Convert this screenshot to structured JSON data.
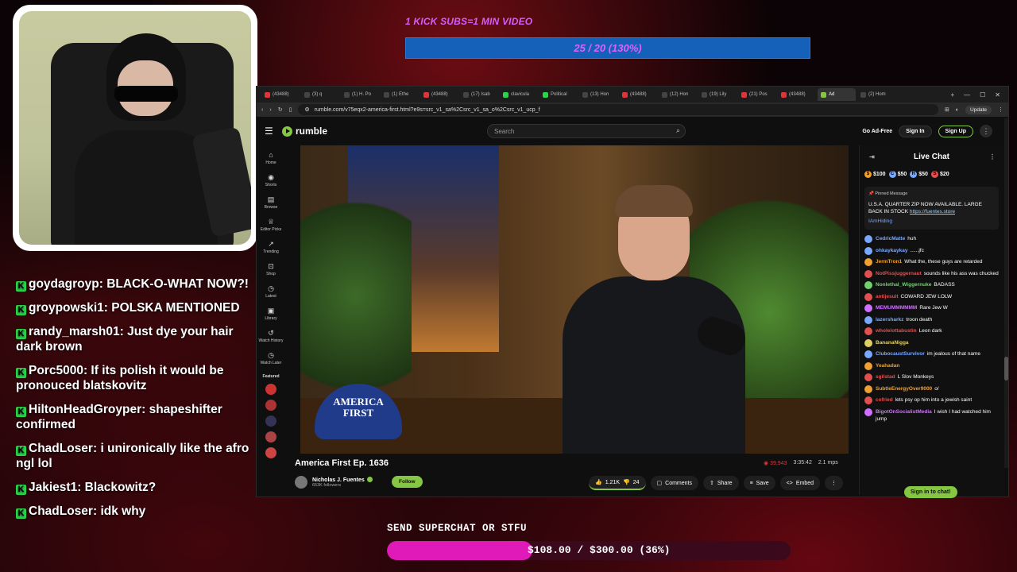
{
  "overlay": {
    "kick_goal_title": "1 KICK SUBS=1 MIN VIDEO",
    "kick_goal_value": "25 / 20 (130%)",
    "superchat_title": "SEND SUPERCHAT OR STFU",
    "superchat_value": "$108.00 / $300.00 (36%)",
    "superchat_progress": 0.36,
    "accent_pink": "#e01ab8",
    "accent_blue": "#1560b8"
  },
  "stream_chat": [
    {
      "user": "goydagroyp:",
      "text": "BLACK-O-WHAT NOW?!"
    },
    {
      "user": "groypowski1:",
      "text": "POLSKA MENTIONED"
    },
    {
      "user": "randy_marsh01:",
      "text": "Just dye your hair dark brown"
    },
    {
      "user": "Porc5000:",
      "text": "If its polish it would be pronouced blatskovitz"
    },
    {
      "user": "HiltonHeadGroyper:",
      "text": "shapeshifter confirmed"
    },
    {
      "user": "ChadLoser:",
      "text": "i unironically like the afro ngl lol"
    },
    {
      "user": "Jakiest1:",
      "text": "Blackowitz?"
    },
    {
      "user": "ChadLoser:",
      "text": "idk why"
    }
  ],
  "browser": {
    "tabs": [
      "(43488)",
      "(3) q",
      "(1) H. Po",
      "(1) Ethe",
      "(43488)",
      "(17) Isab",
      "clavicula",
      "Political",
      "(13) Hon",
      "(43488)",
      "(12) Hon",
      "(19) Lily",
      "(21) Pos",
      "(43488)",
      "Ad",
      "(2) Hom"
    ],
    "url": "rumble.com/v75eqx2-america-first.html?e9s=src_v1_sa%2Csrc_v1_sa_o%2Csrc_v1_ucp_f",
    "update_label": "Update"
  },
  "rumble": {
    "logo": "rumble",
    "search_placeholder": "Search",
    "ad_free": "Go Ad-Free",
    "sign_in": "Sign In",
    "sign_up": "Sign Up",
    "nav": [
      {
        "label": "Home",
        "icon": "home-icon",
        "glyph": "⌂"
      },
      {
        "label": "Shorts",
        "icon": "shorts-icon",
        "glyph": "◉"
      },
      {
        "label": "Browse",
        "icon": "browse-icon",
        "glyph": "▤"
      },
      {
        "label": "Editor Picks",
        "icon": "editor-picks-icon",
        "glyph": "♕"
      },
      {
        "label": "Trending",
        "icon": "trending-icon",
        "glyph": "↗"
      },
      {
        "label": "Shop",
        "icon": "shop-icon",
        "glyph": "⊡"
      },
      {
        "label": "Latest",
        "icon": "latest-icon",
        "glyph": "◷"
      },
      {
        "label": "Library",
        "icon": "library-icon",
        "glyph": "▣"
      },
      {
        "label": "Watch History",
        "icon": "history-icon",
        "glyph": "↺"
      },
      {
        "label": "Watch Later",
        "icon": "watch-later-icon",
        "glyph": "◷"
      }
    ],
    "featured_label": "Featured",
    "hat_text": "AMERICA FIRST",
    "video_title": "America First Ep. 1636",
    "viewers": "39,943",
    "duration": "3:35:42",
    "bitrate": "2.1 mps",
    "channel_name": "Nicholas J. Fuentes",
    "followers": "653K followers",
    "follow": "Follow",
    "likes": "1.21K",
    "dislikes": "24",
    "comments": "Comments",
    "share": "Share",
    "save": "Save",
    "embed": "Embed"
  },
  "live_chat": {
    "title": "Live Chat",
    "rants": [
      "$100",
      "$50",
      "$50",
      "$20"
    ],
    "pinned_label": "Pinned Message",
    "pinned_text": "U.S.A. QUARTER ZIP NOW AVAILABLE. LARGE BACK IN STOCK",
    "pinned_link": "https://fuentes.store",
    "pinned_author": "IAmHiding",
    "messages": [
      {
        "user": "CedricMatte",
        "text": "huh",
        "color": "#7aa8ff"
      },
      {
        "user": "ohkaykaykay",
        "text": "......jfc",
        "color": "#7aa8ff"
      },
      {
        "user": "JermTron1",
        "text": "What the, these guys are retarded",
        "color": "#f0a030"
      },
      {
        "user": "NotPissjuggernaut",
        "text": "sounds like his ass was chucked",
        "color": "#e05050"
      },
      {
        "user": "Nonlethal_Wiggernuke",
        "text": "BADASS",
        "color": "#70d070"
      },
      {
        "user": "antijesuit",
        "text": "COWARD JEW LOLW",
        "color": "#e05050"
      },
      {
        "user": "MEMUMMMMMM",
        "text": "Rare Jew W",
        "color": "#d070ff"
      },
      {
        "user": "lazersharkz",
        "text": "troon death",
        "color": "#7aa8ff"
      },
      {
        "user": "wholelottabustin",
        "text": "Leon dark",
        "color": "#e05050"
      },
      {
        "user": "BananaNigga",
        "text": "",
        "color": "#e0d060"
      },
      {
        "user": "ClubocaustSurvivor",
        "text": "im jealous of that name",
        "color": "#7aa8ff"
      },
      {
        "user": "Yeahadan",
        "text": "",
        "color": "#f0a030"
      },
      {
        "user": "sgilstad",
        "text": "L Slov Monkeys",
        "color": "#e05050"
      },
      {
        "user": "SubtleEnergyOver9000",
        "text": "o/",
        "color": "#f0a030"
      },
      {
        "user": "cofried",
        "text": "lets psy op him into a jewish saint",
        "color": "#e05050"
      },
      {
        "user": "BigotOnSocialistMedia",
        "text": "I wish I had watched him jump",
        "color": "#d070ff"
      }
    ],
    "sign_in_chat": "Sign in to chat!"
  }
}
